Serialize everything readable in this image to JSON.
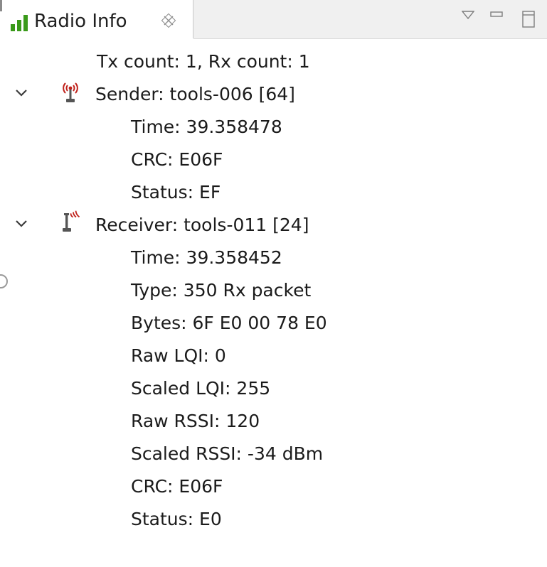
{
  "tab": {
    "title": "Radio Info",
    "icon": "signal-bars-icon",
    "close_icon": "close-icon"
  },
  "toolbar": {
    "view_menu_icon": "triangle-down-icon",
    "minimize_icon": "minimize-icon",
    "maximize_icon": "maximize-icon"
  },
  "tree": {
    "summary": "Tx count: 1, Rx count: 1",
    "sender": {
      "label": "Sender: tools-006 [64]",
      "icon": "antenna-transmit-icon",
      "expanded": true,
      "children": [
        "Time: 39.358478",
        "CRC: E06F",
        "Status: EF"
      ]
    },
    "receiver": {
      "label": "Receiver: tools-011 [24]",
      "icon": "antenna-receive-icon",
      "expanded": true,
      "children": [
        "Time: 39.358452",
        "Type: 350 Rx packet",
        "Bytes: 6F E0 00 78 E0",
        "Raw LQI: 0",
        "Scaled LQI: 255",
        "Raw RSSI: 120",
        "Scaled RSSI: -34 dBm",
        "CRC: E06F",
        "Status: E0"
      ]
    }
  },
  "colors": {
    "signal_green": "#3a9a1a",
    "antenna_red": "#c0201a",
    "text": "#1b1b1b",
    "tabbar_bg": "#f0f0f0"
  }
}
